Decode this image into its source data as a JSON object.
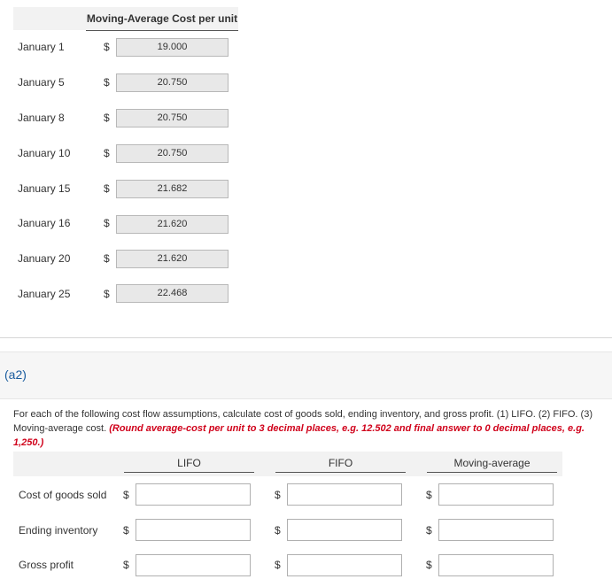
{
  "top_table": {
    "header": "Moving-Average Cost per unit",
    "currency": "$",
    "rows": [
      {
        "label": "January 1",
        "value": "19.000"
      },
      {
        "label": "January 5",
        "value": "20.750"
      },
      {
        "label": "January 8",
        "value": "20.750"
      },
      {
        "label": "January 10",
        "value": "20.750"
      },
      {
        "label": "January 15",
        "value": "21.682"
      },
      {
        "label": "January 16",
        "value": "21.620"
      },
      {
        "label": "January 20",
        "value": "21.620"
      },
      {
        "label": "January 25",
        "value": "22.468"
      }
    ]
  },
  "section": {
    "label": "(a2)",
    "instructions": "For each of the following cost flow assumptions, calculate cost of goods sold, ending inventory, and gross profit. (1) LIFO. (2) FIFO. (3) Moving-average cost.",
    "instructions_note": "(Round average-cost per unit to 3 decimal places, e.g. 12.502 and final answer to 0 decimal places, e.g. 1,250.)"
  },
  "bottom_table": {
    "currency": "$",
    "columns": [
      "LIFO",
      "FIFO",
      "Moving-average"
    ],
    "rows": [
      {
        "label": "Cost of goods sold",
        "values": [
          "",
          "",
          ""
        ]
      },
      {
        "label": "Ending inventory",
        "values": [
          "",
          "",
          ""
        ]
      },
      {
        "label": "Gross profit",
        "values": [
          "",
          "",
          ""
        ]
      }
    ]
  }
}
